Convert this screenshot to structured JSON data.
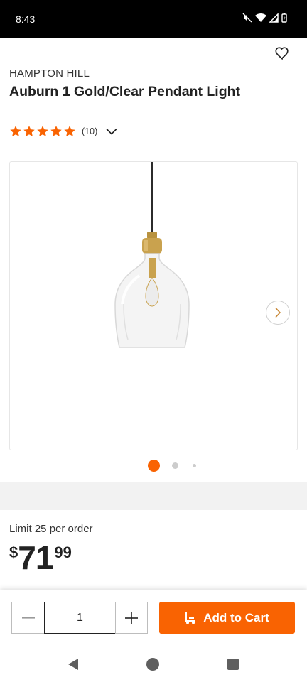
{
  "status_bar": {
    "time": "8:43",
    "icons": [
      "mute-icon",
      "wifi-icon",
      "signal-icon",
      "battery-icon"
    ]
  },
  "product": {
    "brand": "HAMPTON HILL",
    "title": "Auburn 1 Gold/Clear Pendant Light",
    "rating": {
      "stars": 5,
      "max_stars": 5,
      "count_text": "(10)"
    },
    "favorite_icon": "heart-outline-icon"
  },
  "gallery": {
    "image_description_icon": "pendant-light-image",
    "next_icon": "chevron-right-icon",
    "page_count": 3,
    "active_page": 1
  },
  "purchase": {
    "limit_text": "Limit 25 per order",
    "price_currency": "$",
    "price_dollars": "71",
    "price_cents": "99",
    "quantity": "1",
    "add_to_cart_label": "Add to Cart"
  },
  "colors": {
    "accent": "#f96302",
    "star": "#f96302"
  },
  "nav_bar": {
    "icons": [
      "back-icon",
      "home-icon",
      "recents-icon"
    ]
  }
}
